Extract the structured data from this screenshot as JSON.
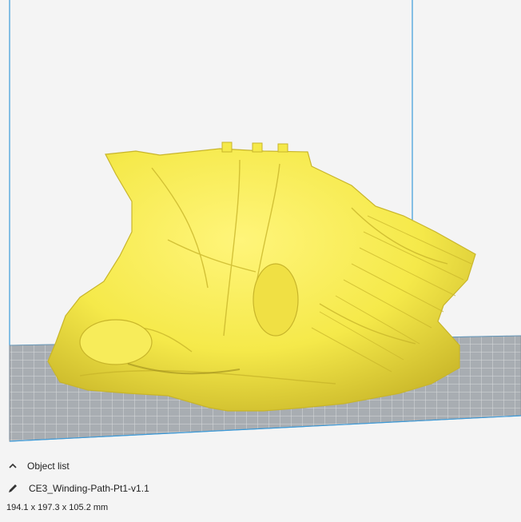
{
  "colors": {
    "background": "#f4f4f4",
    "build_volume_lines": "#3b9ad9",
    "build_plate": "#a8adb2",
    "grid_lines": "#ffffff",
    "model": "#f5e94a",
    "model_shade": "#c8b52a"
  },
  "object_panel": {
    "header_label": "Object list",
    "header_icon": "chevron-up-icon",
    "edit_icon": "pencil-icon",
    "object_name": "CE3_Winding-Path-Pt1-v1.1",
    "dimensions": "194.1 x 197.3 x 105.2 mm"
  }
}
